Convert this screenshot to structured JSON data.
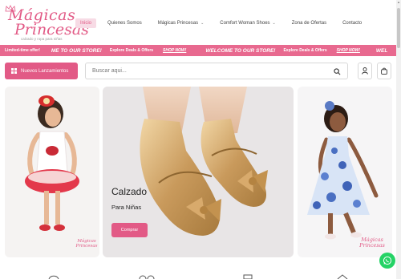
{
  "brand": {
    "logo_top": "Mágicas",
    "logo_bottom": "Princesas",
    "tagline": "calzado y ropa para niñas"
  },
  "nav": {
    "items": [
      {
        "label": "Inicio",
        "active": true,
        "has_caret": false
      },
      {
        "label": "Quienes Somos",
        "active": false,
        "has_caret": false
      },
      {
        "label": "Mágicas Princesas",
        "active": false,
        "has_caret": true
      },
      {
        "label": "Comfort Woman Shoes",
        "active": false,
        "has_caret": true
      },
      {
        "label": "Zona de Ofertas",
        "active": false,
        "has_caret": false
      },
      {
        "label": "Contacto",
        "active": false,
        "has_caret": false
      }
    ]
  },
  "marquee": {
    "items": [
      "Limited-time offer!",
      "ME TO OUR STORE!",
      "Explore Deals & Offers",
      "SHOP NOW!",
      "WELCOME TO OUR STORE!",
      "Explore Deals & Offers",
      "SHOP NOW!",
      "WEL"
    ]
  },
  "search": {
    "launch_label": "Nuevos Lanzamientos",
    "placeholder": "Buscar aqui..."
  },
  "hero": {
    "title": "Calzado",
    "subtitle": "Para Niñas",
    "button": "Comprar"
  },
  "badges": {
    "left": "Mágicas Princesas",
    "right": "Mágicas Princesas"
  },
  "colors": {
    "accent": "#e25a86",
    "marquee": "#e8698f",
    "whatsapp": "#25d366"
  },
  "icons": [
    "crown-icon",
    "grid-icon",
    "search-icon",
    "user-icon",
    "bag-icon",
    "whatsapp-icon",
    "chevron-down-icon"
  ]
}
